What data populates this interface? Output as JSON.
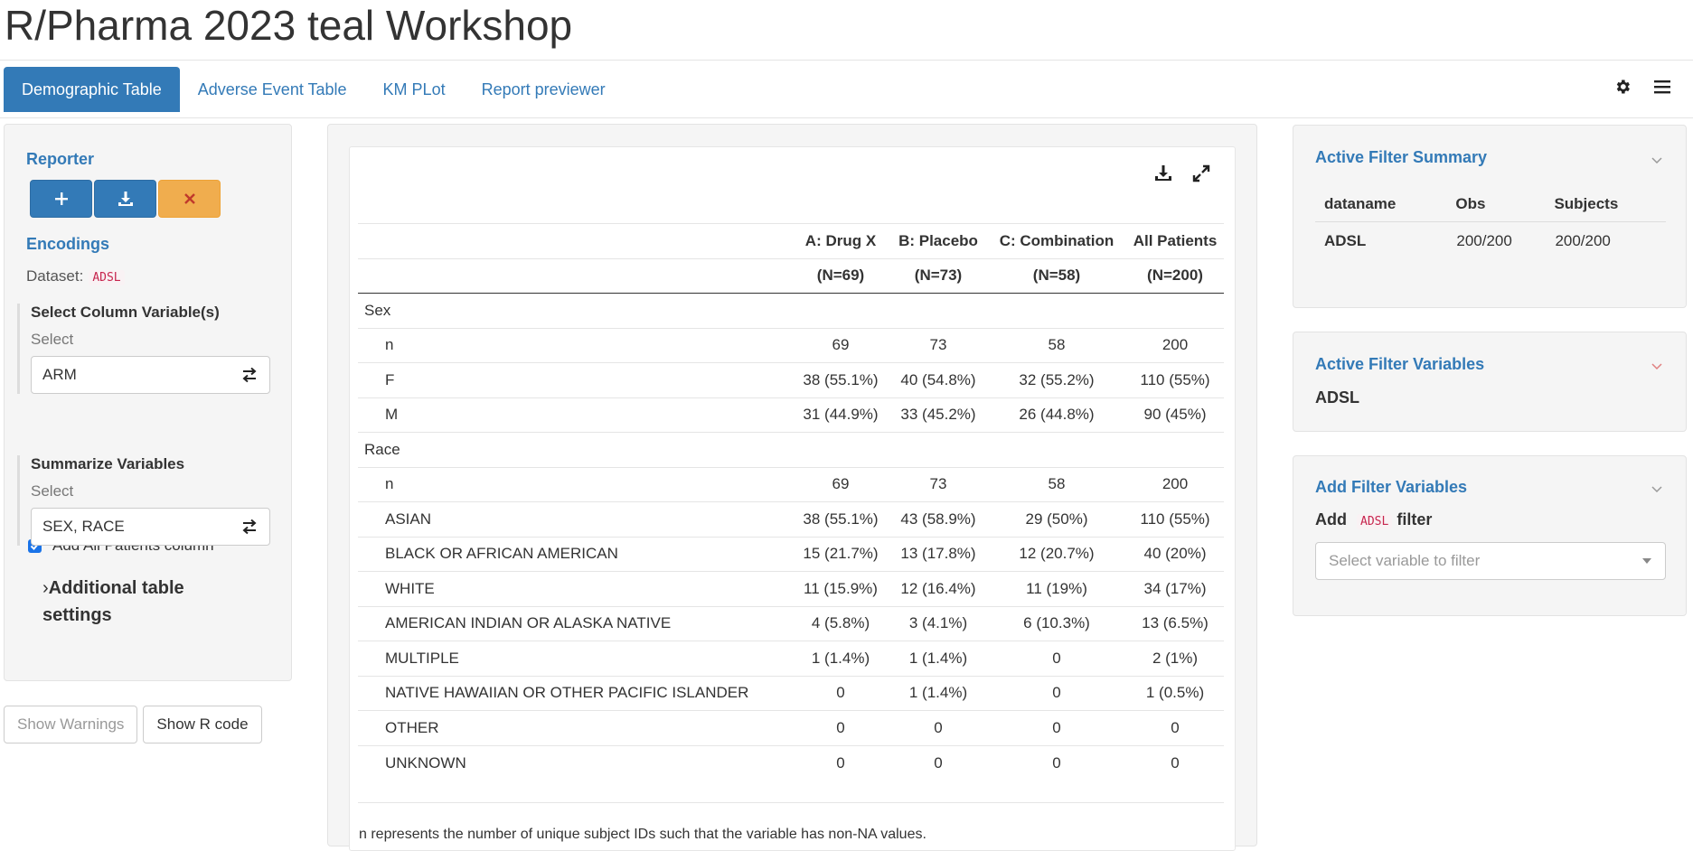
{
  "app": {
    "title": "R/Pharma 2023 teal Workshop"
  },
  "tabs": [
    "Demographic Table",
    "Adverse Event Table",
    "KM PLot",
    "Report previewer"
  ],
  "nav_icons": [
    "gear-icon",
    "hamburger-menu-icon"
  ],
  "encoding_panel": {
    "reporter_label": "Reporter",
    "reporter_buttons": [
      "plus-icon",
      "download-icon",
      "close-icon"
    ],
    "encodings_label": "Encodings",
    "dataset_label": "Dataset:",
    "dataset_value": "ADSL",
    "column_var_label": "Select Column Variable(s)",
    "column_var_sub": "Select",
    "column_var_value": "ARM",
    "add_all_patients_label": "Add All Patients column",
    "add_all_patients_checked": true,
    "summarize_label": "Summarize Variables",
    "summarize_sub": "Select",
    "summarize_value": "SEX, RACE",
    "additional_settings_label": "Additional table settings",
    "show_warnings_label": "Show Warnings",
    "show_r_code_label": "Show R code"
  },
  "table": {
    "columns": [
      "A: Drug X",
      "B: Placebo",
      "C: Combination",
      "All Patients"
    ],
    "ns": [
      "(N=69)",
      "(N=73)",
      "(N=58)",
      "(N=200)"
    ],
    "groups": [
      {
        "label": "Sex",
        "rows": [
          {
            "label": "n",
            "values": [
              "69",
              "73",
              "58",
              "200"
            ]
          },
          {
            "label": "F",
            "values": [
              "38 (55.1%)",
              "40 (54.8%)",
              "32 (55.2%)",
              "110 (55%)"
            ]
          },
          {
            "label": "M",
            "values": [
              "31 (44.9%)",
              "33 (45.2%)",
              "26 (44.8%)",
              "90 (45%)"
            ]
          }
        ]
      },
      {
        "label": "Race",
        "rows": [
          {
            "label": "n",
            "values": [
              "69",
              "73",
              "58",
              "200"
            ]
          },
          {
            "label": "ASIAN",
            "values": [
              "38 (55.1%)",
              "43 (58.9%)",
              "29 (50%)",
              "110 (55%)"
            ]
          },
          {
            "label": "BLACK OR AFRICAN AMERICAN",
            "values": [
              "15 (21.7%)",
              "13 (17.8%)",
              "12 (20.7%)",
              "40 (20%)"
            ]
          },
          {
            "label": "WHITE",
            "values": [
              "11 (15.9%)",
              "12 (16.4%)",
              "11 (19%)",
              "34 (17%)"
            ]
          },
          {
            "label": "AMERICAN INDIAN OR ALASKA NATIVE",
            "values": [
              "4 (5.8%)",
              "3 (4.1%)",
              "6 (10.3%)",
              "13 (6.5%)"
            ]
          },
          {
            "label": "MULTIPLE",
            "values": [
              "1 (1.4%)",
              "1 (1.4%)",
              "0",
              "2 (1%)"
            ]
          },
          {
            "label": "NATIVE HAWAIIAN OR OTHER PACIFIC ISLANDER",
            "values": [
              "0",
              "1 (1.4%)",
              "0",
              "1 (0.5%)"
            ]
          },
          {
            "label": "OTHER",
            "values": [
              "0",
              "0",
              "0",
              "0"
            ]
          },
          {
            "label": "UNKNOWN",
            "values": [
              "0",
              "0",
              "0",
              "0"
            ]
          }
        ]
      }
    ],
    "footnote": "n represents the number of unique subject IDs such that the variable has non-NA values."
  },
  "filter_panel": {
    "summary_title": "Active Filter Summary",
    "summary_headers": [
      "dataname",
      "Obs",
      "Subjects"
    ],
    "summary_rows": [
      [
        "ADSL",
        "200/200",
        "200/200"
      ]
    ],
    "variables_title": "Active Filter Variables",
    "variables_dataset": "ADSL",
    "add_title": "Add Filter Variables",
    "add_prefix": "Add",
    "add_dataset": "ADSL",
    "add_suffix": "filter",
    "add_placeholder": "Select variable to filter"
  },
  "colors": {
    "primary": "#337ab7",
    "warning": "#f0ad4e",
    "code": "#c7254e"
  }
}
